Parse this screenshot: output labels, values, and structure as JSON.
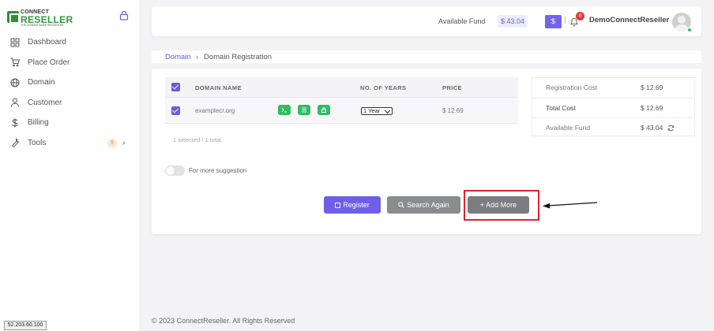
{
  "brand": {
    "line1": "CONNECT",
    "line2": "RESELLER",
    "tagline": "THE DOMAIN NAME REGISTRAR"
  },
  "sidebar": {
    "items": [
      {
        "label": "Dashboard",
        "icon": "grid-icon"
      },
      {
        "label": "Place Order",
        "icon": "cart-icon"
      },
      {
        "label": "Domain",
        "icon": "globe-icon"
      },
      {
        "label": "Customer",
        "icon": "user-icon"
      },
      {
        "label": "Billing",
        "icon": "dollar-icon"
      },
      {
        "label": "Tools",
        "icon": "wrench-icon",
        "badge": "9"
      }
    ]
  },
  "header": {
    "fund_label": "Available Fund",
    "fund_value": "$ 43.04",
    "dollar_button": "$",
    "separator": "|",
    "notification_count": "0",
    "username": "DemoConnectReseller"
  },
  "breadcrumb": {
    "link": "Domain",
    "separator": "›",
    "current": "Domain Registration"
  },
  "table": {
    "headers": {
      "name": "DOMAIN NAME",
      "years": "NO. OF YEARS",
      "price": "PRICE"
    },
    "rows": [
      {
        "domain": "examplecr.org",
        "years": "1 Year",
        "price": "$ 12.69",
        "checked": true
      }
    ],
    "selected_text": "1 selected / 1 total"
  },
  "suggestion_toggle": {
    "label": "For more suggestion",
    "on": false
  },
  "summary": {
    "rows": [
      {
        "label": "Registration Cost",
        "value": "$ 12.69"
      },
      {
        "label": "Total Cost",
        "value": "$ 12.69"
      },
      {
        "label": "Available Fund",
        "value": "$ 43.04"
      }
    ]
  },
  "actions": {
    "register": "Register",
    "search_again": "Search Again",
    "add_more": "+ Add More"
  },
  "footer": "© 2023 ConnectReseller. All Rights Reserved",
  "ip_address": "52.203.60.100",
  "colors": {
    "accent": "#6f5ee9",
    "green": "#2ebd62",
    "highlight": "#e0242c"
  }
}
